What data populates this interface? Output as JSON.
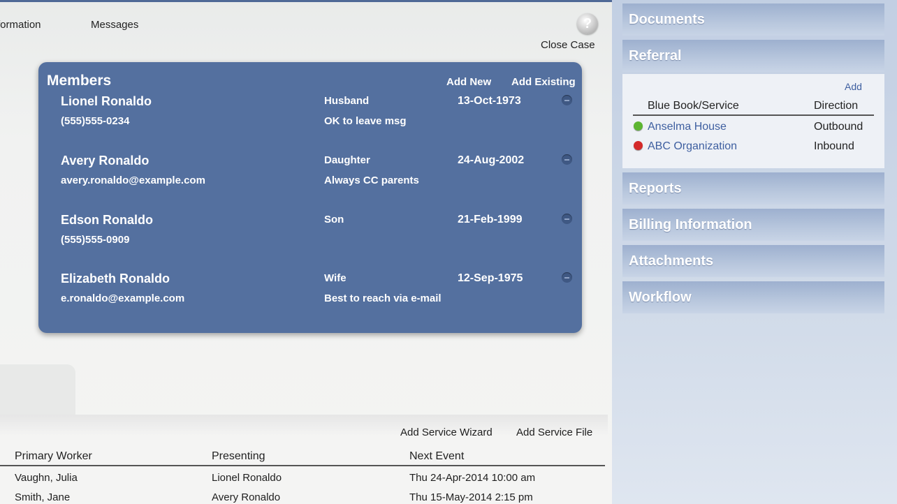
{
  "tabs": [
    "formation",
    "Messages"
  ],
  "help": {
    "label": "?"
  },
  "close_case": "Close Case",
  "members": {
    "title": "Members",
    "add_new": "Add New",
    "add_existing": "Add Existing",
    "list": [
      {
        "name": "Lionel Ronaldo",
        "contact": "(555)555-0234",
        "relation": "Husband",
        "note": "OK to leave msg",
        "dob": "13-Oct-1973"
      },
      {
        "name": "Avery Ronaldo",
        "contact": "avery.ronaldo@example.com",
        "relation": "Daughter",
        "note": "Always CC parents",
        "dob": "24-Aug-2002"
      },
      {
        "name": "Edson Ronaldo",
        "contact": "(555)555-0909",
        "relation": "Son",
        "note": "",
        "dob": "21-Feb-1999"
      },
      {
        "name": "Elizabeth Ronaldo",
        "contact": "e.ronaldo@example.com",
        "relation": "Wife",
        "note": "Best to reach via e-mail",
        "dob": "12-Sep-1975"
      }
    ]
  },
  "services": {
    "add_wizard": "Add Service Wizard",
    "add_file": "Add Service File",
    "headers": [
      "Primary Worker",
      "Presenting",
      "Next Event"
    ],
    "rows": [
      [
        "Vaughn, Julia",
        "Lionel Ronaldo",
        "Thu 24-Apr-2014 10:00 am"
      ],
      [
        "Smith, Jane",
        "Avery Ronaldo",
        "Thu 15-May-2014 2:15 pm"
      ]
    ]
  },
  "sidebar": {
    "documents": "Documents",
    "referral": "Referral",
    "referral_panel": {
      "add": "Add",
      "headers": [
        "Blue Book/Service",
        "Direction"
      ],
      "rows": [
        {
          "name": "Anselma House",
          "direction": "Outbound",
          "status_color": "#5cb531"
        },
        {
          "name": "ABC Organization",
          "direction": "Inbound",
          "status_color": "#d42a2a"
        }
      ]
    },
    "reports": "Reports",
    "billing": "Billing Information",
    "attachments": "Attachments",
    "workflow": "Workflow"
  },
  "colors": {
    "card_blue": "#54709f",
    "link_blue": "#3e5fa0"
  }
}
